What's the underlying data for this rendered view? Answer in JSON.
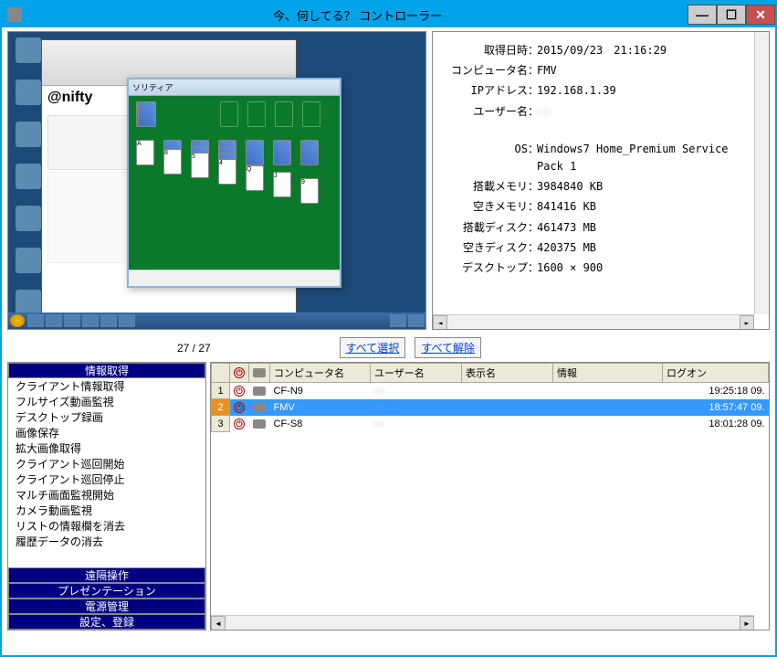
{
  "window": {
    "title": "今、何してる？ コントローラー"
  },
  "info": {
    "label_datetime": "取得日時",
    "datetime": "2015/09/23　21:16:29",
    "label_computer": "コンピュータ名",
    "computer": "FMV",
    "label_ip": "IPアドレス",
    "ip": "192.168.1.39",
    "label_user": "ユーザー名",
    "user": "——",
    "label_os": "OS",
    "os": "Windows7 Home_Premium Service Pack 1",
    "label_ram": "搭載メモリ",
    "ram": "3984840 KB",
    "label_freeram": "空きメモリ",
    "freeram": "841416 KB",
    "label_disk": "搭載ディスク",
    "disk": "461473 MB",
    "label_freedisk": "空きディスク",
    "freedisk": "420375 MB",
    "label_desktop": "デスクトップ",
    "desktop": "1600 × 900"
  },
  "counter": "27 / 27",
  "buttons": {
    "select_all": "すべて選択",
    "deselect_all": "すべて解除"
  },
  "categories": {
    "info": "情報取得",
    "remote": "遠隔操作",
    "presentation": "プレゼンテーション",
    "power": "電源管理",
    "settings": "設定、登録"
  },
  "actions": [
    "クライアント情報取得",
    "フルサイズ動画監視",
    "デスクトップ録画",
    "画像保存",
    "拡大画像取得",
    "クライアント巡回開始",
    "クライアント巡回停止",
    "マルチ画面監視開始",
    "カメラ動画監視",
    "リストの情報欄を消去",
    "履歴データの消去"
  ],
  "table": {
    "headers": {
      "power": "",
      "link": "",
      "computer": "コンピュータ名",
      "user": "ユーザー名",
      "display": "表示名",
      "info": "情報",
      "logon": "ログオン"
    },
    "rows": [
      {
        "num": "1",
        "computer": "CF-N9",
        "user": "",
        "display": "",
        "info": "",
        "logon": "19:25:18 09.",
        "selected": false
      },
      {
        "num": "2",
        "computer": "FMV",
        "user": "",
        "display": "",
        "info": "",
        "logon": "18:57:47 09.",
        "selected": true
      },
      {
        "num": "3",
        "computer": "CF-S8",
        "user": "",
        "display": "",
        "info": "",
        "logon": "18:01:28 09.",
        "selected": false
      }
    ]
  },
  "screenshot": {
    "browser_title": "@nifty",
    "solitaire_title": "ソリティア"
  }
}
